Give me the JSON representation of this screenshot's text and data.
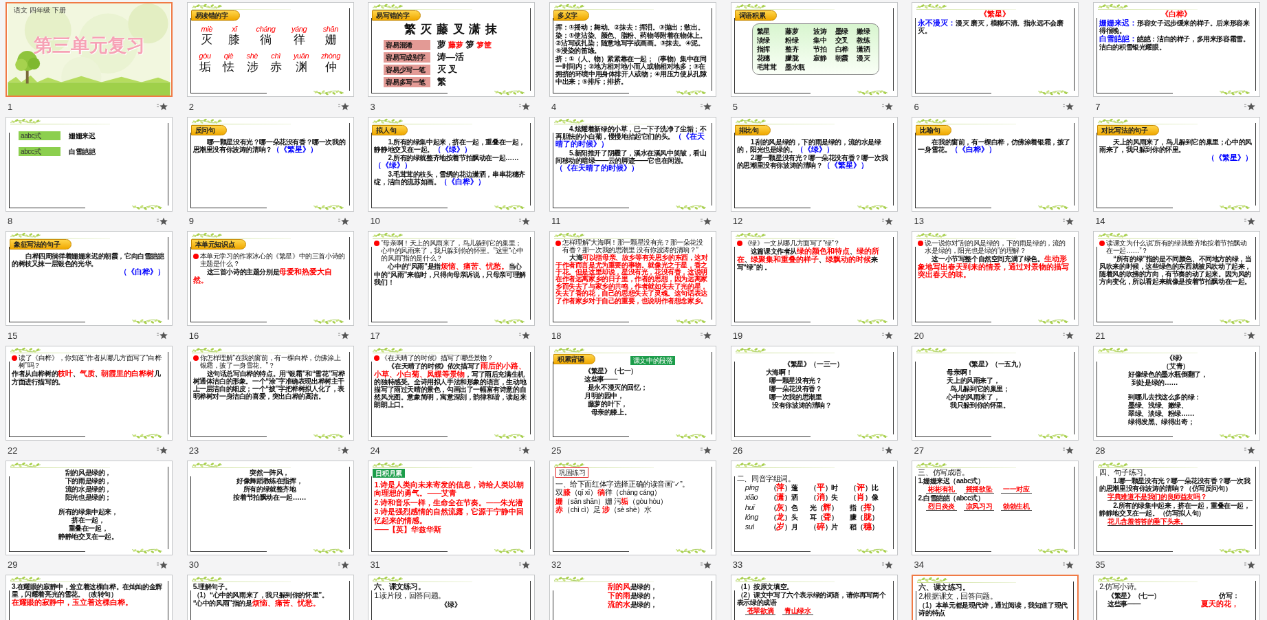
{
  "slides": [
    {
      "number": "1",
      "selected": true,
      "kind": "title",
      "header": "语文  四年级  下册",
      "title": "第三单元复习"
    },
    {
      "number": "2",
      "selected": false,
      "kind": "content",
      "label": {
        "text": "易读错的字",
        "kind": "tab"
      },
      "body": [
        {
          "kind": "pinyin-row",
          "cells": [
            {
              "pinyin": "miè",
              "char": "灭"
            },
            {
              "pinyin": "xī",
              "char": "膝"
            },
            {
              "pinyin": "cháng",
              "char": "徜"
            },
            {
              "pinyin": "yáng",
              "char": "徉"
            },
            {
              "pinyin": "shān",
              "char": "姗"
            }
          ]
        },
        {
          "kind": "pinyin-row",
          "cells": [
            {
              "pinyin": "gòu",
              "char": "垢"
            },
            {
              "pinyin": "qiè",
              "char": "怯"
            },
            {
              "pinyin": "shè",
              "char": "涉"
            },
            {
              "pinyin": "chì",
              "char": "赤"
            },
            {
              "pinyin": "yuān",
              "char": "渊"
            },
            {
              "pinyin": "zhòng",
              "char": "仲"
            }
          ]
        }
      ]
    },
    {
      "number": "3",
      "selected": false,
      "kind": "content",
      "label": {
        "text": "易写错的字",
        "kind": "tab"
      },
      "body": [
        {
          "kind": "big",
          "parts": [
            {
              "text": "繁 灭 藤 叉 潇 抹"
            }
          ]
        },
        {
          "kind": "chip-row",
          "chip": "容易混淆",
          "parts": [
            {
              "text": "萝 "
            },
            {
              "text": "藤萝",
              "color": "#ff0000"
            },
            {
              "text": "  箩 "
            },
            {
              "text": "箩筐",
              "color": "#ff0000"
            }
          ]
        },
        {
          "kind": "chip-row",
          "chip": "容易写成别字",
          "parts": [
            {
              "text": "涛—活"
            }
          ]
        },
        {
          "kind": "chip-row",
          "chip": "容易少写一笔",
          "parts": [
            {
              "text": "灭    叉"
            }
          ]
        },
        {
          "kind": "chip-row",
          "chip": "容易多写一笔",
          "parts": [
            {
              "text": "繁"
            }
          ]
        }
      ]
    },
    {
      "number": "4",
      "selected": false,
      "kind": "content",
      "label": {
        "text": "多义字",
        "kind": "tab"
      },
      "body": [
        {
          "kind": "line",
          "parts": [
            {
              "text": "挥：①摇动；舞动。②抹去：挥泪。③抛出；散出。"
            }
          ]
        },
        {
          "kind": "line",
          "parts": [
            {
              "text": "染：①使沾染、颜色、脂粉、药物等附着在物体上。②沾写或扎染；随意地写字或画画。③抹去。④泥。⑤浸染的笛绦。"
            }
          ]
        },
        {
          "kind": "line",
          "parts": [
            {
              "text": "挤：①（人、物）紧紧靠在一起；（事物）集中在同一时间内；②地方相对地小而人或物相对地多；③在拥挤的环境中用身体排开人或物；④用压力使从孔隙中出来；⑤排斥；排挤。"
            }
          ]
        }
      ]
    },
    {
      "number": "5",
      "selected": false,
      "kind": "content",
      "label": {
        "text": "词语积累",
        "kind": "tab"
      },
      "body": [
        {
          "kind": "word-box",
          "rows": [
            [
              "繁星",
              "藤萝",
              "波涛",
              "墨绿",
              "嫩绿"
            ],
            [
              "淡绿",
              "粉绿",
              "集中",
              "交叉",
              "教练"
            ],
            [
              "指挥",
              "整齐",
              "节拍",
              "白桦",
              "潇洒"
            ],
            [
              "花穗",
              "朦胧",
              "寂静",
              "朝霞",
              "漫灭"
            ],
            [
              "毛茸茸",
              "墨水瓶"
            ]
          ]
        }
      ]
    },
    {
      "number": "6",
      "selected": false,
      "kind": "content",
      "body": [
        {
          "kind": "center",
          "parts": [
            {
              "text": "《繁星》",
              "color": "#ff0000"
            }
          ]
        },
        {
          "kind": "line",
          "parts": [
            {
              "text": "永不漫灭：",
              "color": "#0000ff"
            },
            {
              "text": "漫灭 磨灭，模糊不清。指永远不会磨灭。"
            }
          ]
        }
      ]
    },
    {
      "number": "7",
      "selected": false,
      "kind": "content",
      "body": [
        {
          "kind": "center",
          "parts": [
            {
              "text": "《白桦》",
              "color": "#ff0000"
            }
          ]
        },
        {
          "kind": "line",
          "parts": [
            {
              "text": "姗姗来迟：",
              "color": "#0000ff"
            },
            {
              "text": "形容女子迟步缓来的样子。后来形容来得很晚。"
            }
          ]
        },
        {
          "kind": "line",
          "parts": [
            {
              "text": "白雪皑皑：",
              "color": "#0000ff"
            },
            {
              "text": "皑皑：洁白的样子，多用来形容霜雪。洁白的积雪银光耀眼。"
            }
          ]
        }
      ]
    },
    {
      "number": "8",
      "selected": false,
      "kind": "content",
      "body": [
        {
          "kind": "gap"
        },
        {
          "kind": "green-tag-row",
          "tag": "aabc式",
          "text": "姗姗来迟"
        },
        {
          "kind": "gap"
        },
        {
          "kind": "green-tag-row",
          "tag": "abcc式",
          "text": "白雪皑皑"
        }
      ]
    },
    {
      "number": "9",
      "selected": false,
      "kind": "content",
      "label": {
        "text": "反问句",
        "kind": "tab"
      },
      "body": [
        {
          "kind": "para",
          "parts": [
            {
              "text": "哪一颗星没有光？哪一朵花没有香？哪一次我的思潮里没有你波涛的清响？"
            },
            {
              "text": "（《繁星》）",
              "color": "#0000ff"
            }
          ]
        }
      ]
    },
    {
      "number": "10",
      "selected": false,
      "kind": "content",
      "label": {
        "text": "拟人句",
        "kind": "tab"
      },
      "body": [
        {
          "kind": "para",
          "parts": [
            {
              "text": "1.所有的绿集中起来，挤在一起，重叠在一起，静静地交叉在一起。"
            },
            {
              "text": "（《绿》）",
              "color": "#0000ff"
            }
          ]
        },
        {
          "kind": "para",
          "parts": [
            {
              "text": "2.所有的绿就整齐地按着节拍飘动在一起……"
            },
            {
              "text": "（《绿》）",
              "color": "#0000ff"
            }
          ]
        },
        {
          "kind": "para",
          "parts": [
            {
              "text": "3.毛茸茸的枝头，雪绣的花边潇洒，串串花穗齐绽，洁白的流苏如画。"
            },
            {
              "text": "（《白桦》）",
              "color": "#0000ff"
            }
          ]
        }
      ]
    },
    {
      "number": "11",
      "selected": false,
      "kind": "content",
      "body": [
        {
          "kind": "para",
          "parts": [
            {
              "text": "4.炫耀着新绿的小草，已一下子洗净了尘垢；不再胆怯的小白菊，慢慢地抬起它们的头。"
            },
            {
              "text": "（《在天晴了的时候》）",
              "color": "#0000ff"
            }
          ]
        },
        {
          "kind": "para",
          "parts": [
            {
              "text": "5.新阳推开了阴霾了，溪水在溪风中笑皱，看山间移动的暗绿——云的脚迹——它也在闲游。"
            },
            {
              "text": "（《在天晴了的时候》）",
              "color": "#0000ff"
            }
          ]
        }
      ]
    },
    {
      "number": "12",
      "selected": false,
      "kind": "content",
      "label": {
        "text": "排比句",
        "kind": "tab"
      },
      "body": [
        {
          "kind": "para",
          "parts": [
            {
              "text": "1.刮的风是绿的，下的雨是绿的，流的水是绿的，阳光也是绿的。"
            },
            {
              "text": "（《绿》）",
              "color": "#0000ff"
            }
          ]
        },
        {
          "kind": "para",
          "parts": [
            {
              "text": "2.哪一颗星没有光？哪一朵花没有香？哪一次我的思潮里没有你波涛的清响？"
            },
            {
              "text": "（《繁星》）",
              "color": "#0000ff"
            }
          ]
        }
      ]
    },
    {
      "number": "13",
      "selected": false,
      "kind": "content",
      "label": {
        "text": "比喻句",
        "kind": "tab"
      },
      "body": [
        {
          "kind": "para",
          "parts": [
            {
              "text": "在我的窗前，有一棵白桦，仿佛涂着银霜，披了一身雪花。"
            },
            {
              "text": "（《白桦》）",
              "color": "#0000ff"
            }
          ]
        }
      ]
    },
    {
      "number": "14",
      "selected": false,
      "kind": "content",
      "label": {
        "text": "对比写法的句子",
        "kind": "tab"
      },
      "body": [
        {
          "kind": "para",
          "parts": [
            {
              "text": "天上的风雨来了，鸟儿躲到它的巢里；心中的风雨来了，我只躲到你的怀里。"
            }
          ]
        },
        {
          "kind": "right",
          "parts": [
            {
              "text": "（《繁星》）",
              "color": "#0000ff"
            }
          ]
        }
      ]
    },
    {
      "number": "15",
      "selected": false,
      "kind": "content",
      "label": {
        "text": "象征写法的句子",
        "kind": "tab"
      },
      "body": [
        {
          "kind": "para",
          "parts": [
            {
              "text": "白桦四周徜徉着姗姗来迟的朝霞，它向白雪皑皑的树枝又抹一层银色的光华。"
            }
          ]
        },
        {
          "kind": "right",
          "parts": [
            {
              "text": "（《白桦》）",
              "color": "#0000ff"
            }
          ]
        }
      ]
    },
    {
      "number": "16",
      "selected": false,
      "kind": "content",
      "label": {
        "text": "本单元知识点",
        "kind": "tab"
      },
      "body": [
        {
          "kind": "question",
          "parts": [
            {
              "text": "本单元学习的作家冰心的《繁星》中的三首小诗的主题是什么？"
            }
          ]
        },
        {
          "kind": "para",
          "parts": [
            {
              "text": "这三首小诗的主题分别是"
            },
            {
              "text": "母爱和热爱大自然。",
              "color": "#ff0000"
            }
          ]
        }
      ]
    },
    {
      "number": "17",
      "selected": false,
      "kind": "content",
      "body": [
        {
          "kind": "question",
          "parts": [
            {
              "text": "“母亲啊！天上的风雨来了，鸟儿躲到它的巢里；心中的风雨来了，我只躲到你的怀里。”这里“心中的风雨”指的是什么？"
            }
          ]
        },
        {
          "kind": "para",
          "parts": [
            {
              "text": "心中的“风雨”是指"
            },
            {
              "text": "烦恼、痛苦、忧愁。",
              "color": "#ff0000"
            },
            {
              "text": "当心中的“风雨”来临时，只得向母亲诉说，只母亲可理解我们！"
            }
          ]
        }
      ]
    },
    {
      "number": "18",
      "selected": false,
      "kind": "content",
      "body": [
        {
          "kind": "question",
          "parts": [
            {
              "text": "怎样理解“大海啊！那一颗星没有光？那一朵花没有香？那一次我的思潮里 没有你波涛的清响？”"
            }
          ]
        },
        {
          "kind": "para",
          "parts": [
            {
              "text": "大海"
            },
            {
              "text": "可以指母亲、故乡等有关思乡的东西，这对于作者而言是尤为重要的事物。就像光之于星，香之于花。但是这里却说，星没有光，花没有香，这说明在作者远离家乡的日子里，作者的思想，因为远离家乡而失去了与家乡的共鸣，作者就如失去了光的星，失去了香的花，自己的思想失去了灵魂。这句话表达了作者家乡对于自己的重要，也说明作者想念家乡。",
              "color": "#ff0000"
            }
          ]
        }
      ]
    },
    {
      "number": "19",
      "selected": false,
      "kind": "content",
      "body": [
        {
          "kind": "question",
          "parts": [
            {
              "text": "《绿》一文从哪几方面写了“绿”？"
            }
          ]
        },
        {
          "kind": "para",
          "parts": [
            {
              "text": "这篇课文作者从"
            },
            {
              "text": "绿的颜色和特点",
              "color": "#ff0000"
            },
            {
              "text": "、"
            },
            {
              "text": "绿的所在",
              "color": "#ff0000"
            },
            {
              "text": "、"
            },
            {
              "text": "绿聚集和重叠的样子",
              "color": "#ff0000"
            },
            {
              "text": "、"
            },
            {
              "text": "绿飘动的时候",
              "color": "#ff0000"
            },
            {
              "text": "来写“绿”的 。"
            }
          ]
        }
      ]
    },
    {
      "number": "20",
      "selected": false,
      "kind": "content",
      "body": [
        {
          "kind": "question",
          "parts": [
            {
              "text": "说一说你对“刮的风是绿的，下的雨是绿的，流的水是绿的，阳光也是绿的”的理解？"
            }
          ]
        },
        {
          "kind": "para",
          "parts": [
            {
              "text": "这一小节写整个自然空间充满了绿色。"
            },
            {
              "text": "生动形象地写出春天到来的情景，通过对景物的描写突出春天的味。",
              "color": "#ff0000"
            }
          ]
        }
      ]
    },
    {
      "number": "21",
      "selected": false,
      "kind": "content",
      "body": [
        {
          "kind": "question",
          "parts": [
            {
              "text": "读课文为什么说“所有的绿就整齐地按着节拍飘动在一起……”？"
            }
          ]
        },
        {
          "kind": "para",
          "parts": [
            {
              "text": "“所有的绿”指的是不同颜色、不同地方的绿，当风吹来的时候，这些绿色的东西就被风吹动了起来，随着风的吹拂的方向，有节奏的动了起来。因为风的方向变化，所以看起来就像是按着节拍飘动在一起。"
            }
          ]
        }
      ]
    },
    {
      "number": "22",
      "selected": false,
      "kind": "content",
      "body": [
        {
          "kind": "question",
          "parts": [
            {
              "text": "读了《白桦》，你知道“作者从哪几方面写了“白桦树”吗？"
            }
          ]
        },
        {
          "kind": "line",
          "parts": [
            {
              "text": "作者从白桦树的"
            },
            {
              "text": "枝叶",
              "color": "#ff0000"
            },
            {
              "text": "、"
            },
            {
              "text": "气质",
              "color": "#ff0000"
            },
            {
              "text": "、"
            },
            {
              "text": "朝霞里的白桦树",
              "color": "#ff0000"
            },
            {
              "text": "几方面进行描写的。"
            }
          ]
        }
      ]
    },
    {
      "number": "23",
      "selected": false,
      "kind": "content",
      "body": [
        {
          "kind": "question",
          "parts": [
            {
              "text": "你怎样理解“在我的窗前，有一棵白桦，仿佛涂上银霜，披了一身雪花。”？"
            }
          ]
        },
        {
          "kind": "para",
          "parts": [
            {
              "text": "这句话总写白桦的特点。用“银霜”和“雪花”写桦树通体洁白的形象。一个“涂”字准确表现出桦树主干上一层洁白的细皮；一个“披”字把桦树拟人化了，表明桦树对一身洁白的喜爱，突出白桦的高洁。"
            }
          ]
        }
      ]
    },
    {
      "number": "24",
      "selected": false,
      "kind": "content",
      "body": [
        {
          "kind": "question",
          "parts": [
            {
              "text": "《在天晴了的时候》描写了哪些景物？"
            }
          ]
        },
        {
          "kind": "para",
          "parts": [
            {
              "text": "《在天晴了的时候》依次描写了"
            },
            {
              "text": "雨后的小路、小草、小白菊、凤蝶等景物",
              "color": "#ff0000"
            },
            {
              "text": "，写了雨后充满生机的独特感受。全诗用拟人手法和形象的语言，生动地描写了雨过天晴的景色，勾画出了一幅富有诗意的自然风光图。意象简明，寓意深刻，韵律和谐，读起来朗朗上口。"
            }
          ]
        }
      ]
    },
    {
      "number": "25",
      "selected": false,
      "kind": "content",
      "label": {
        "text": "积累背诵",
        "kind": "tab"
      },
      "body": [
        {
          "kind": "green-label",
          "text": "课文中的段落"
        },
        {
          "kind": "poem",
          "parts": [
            {
              "text": "《繁星》（七一）"
            }
          ]
        },
        {
          "kind": "poem",
          "parts": [
            {
              "text": "这些事——"
            }
          ]
        },
        {
          "kind": "poem",
          "parts": [
            {
              "text": "  是永不漫灭的回忆；"
            }
          ]
        },
        {
          "kind": "poem",
          "parts": [
            {
              "text": "月明的园中，"
            }
          ]
        },
        {
          "kind": "poem",
          "parts": [
            {
              "text": "  藤萝的叶下，"
            }
          ]
        },
        {
          "kind": "poem",
          "parts": [
            {
              "text": "    母亲的膝上。"
            }
          ]
        }
      ]
    },
    {
      "number": "26",
      "selected": false,
      "kind": "content",
      "body": [
        {
          "kind": "gap"
        },
        {
          "kind": "center",
          "parts": [
            {
              "text": "《繁星》（一三一）"
            }
          ]
        },
        {
          "kind": "poem",
          "parts": [
            {
              "text": "大海啊！"
            }
          ]
        },
        {
          "kind": "poem",
          "parts": [
            {
              "text": "  哪一颗星没有光？"
            }
          ]
        },
        {
          "kind": "poem",
          "parts": [
            {
              "text": "  哪一朵花没有香？"
            }
          ]
        },
        {
          "kind": "poem",
          "parts": [
            {
              "text": "  哪一次我的思潮里"
            }
          ]
        },
        {
          "kind": "poem",
          "parts": [
            {
              "text": "    没有你波涛的清响？"
            }
          ]
        }
      ]
    },
    {
      "number": "27",
      "selected": false,
      "kind": "content",
      "body": [
        {
          "kind": "gap"
        },
        {
          "kind": "center",
          "parts": [
            {
              "text": "《繁星》（一五九）"
            }
          ]
        },
        {
          "kind": "poem",
          "parts": [
            {
              "text": "母亲啊！"
            }
          ]
        },
        {
          "kind": "poem",
          "parts": [
            {
              "text": "天上的风雨来了，"
            }
          ]
        },
        {
          "kind": "poem",
          "parts": [
            {
              "text": "  鸟儿躲到它的巢里；"
            }
          ]
        },
        {
          "kind": "poem",
          "parts": [
            {
              "text": "心中的风雨来了，"
            }
          ]
        },
        {
          "kind": "poem",
          "parts": [
            {
              "text": "  我只躲到你的怀里。"
            }
          ]
        }
      ]
    },
    {
      "number": "28",
      "selected": false,
      "kind": "content",
      "body": [
        {
          "kind": "center",
          "parts": [
            {
              "text": "《绿》"
            }
          ]
        },
        {
          "kind": "center",
          "parts": [
            {
              "text": "（艾青）"
            }
          ]
        },
        {
          "kind": "poem",
          "parts": [
            {
              "text": "好像绿色的墨水瓶倒翻了，"
            }
          ]
        },
        {
          "kind": "poem",
          "parts": [
            {
              "text": "  到处是绿的……"
            }
          ]
        },
        {
          "kind": "gap"
        },
        {
          "kind": "poem",
          "parts": [
            {
              "text": "到哪儿去找这么多的绿："
            }
          ]
        },
        {
          "kind": "poem",
          "parts": [
            {
              "text": "墨绿、浅绿、嫩绿、"
            }
          ]
        },
        {
          "kind": "poem",
          "parts": [
            {
              "text": "翠绿、淡绿、粉绿……"
            }
          ]
        },
        {
          "kind": "poem",
          "parts": [
            {
              "text": "绿得发黑、绿得出奇；"
            }
          ]
        }
      ]
    },
    {
      "number": "29",
      "selected": false,
      "kind": "content",
      "body": [
        {
          "kind": "center",
          "parts": [
            {
              "text": "刮的风是绿的，"
            }
          ]
        },
        {
          "kind": "center",
          "parts": [
            {
              "text": "下的雨是绿的，"
            }
          ]
        },
        {
          "kind": "center",
          "parts": [
            {
              "text": "流的水是绿的，"
            }
          ]
        },
        {
          "kind": "center",
          "parts": [
            {
              "text": "阳光也是绿的；"
            }
          ]
        },
        {
          "kind": "gap"
        },
        {
          "kind": "center",
          "parts": [
            {
              "text": "所有的绿集中起来，"
            }
          ]
        },
        {
          "kind": "center",
          "parts": [
            {
              "text": "挤在一起，"
            }
          ]
        },
        {
          "kind": "center",
          "parts": [
            {
              "text": "重叠在一起，"
            }
          ]
        },
        {
          "kind": "center",
          "parts": [
            {
              "text": "静静地交叉在一起。"
            }
          ]
        }
      ]
    },
    {
      "number": "30",
      "selected": false,
      "kind": "content",
      "body": [
        {
          "kind": "center",
          "parts": [
            {
              "text": "突然一阵风，"
            }
          ]
        },
        {
          "kind": "center",
          "parts": [
            {
              "text": "好像舞蹈教练在指挥，"
            }
          ]
        },
        {
          "kind": "center",
          "parts": [
            {
              "text": "所有的绿就整齐地"
            }
          ]
        },
        {
          "kind": "center",
          "parts": [
            {
              "text": "按着节拍飘动在一起……"
            }
          ]
        }
      ]
    },
    {
      "number": "31",
      "selected": false,
      "kind": "content",
      "label": {
        "text": "日积月累",
        "kind": "green"
      },
      "body": [
        {
          "kind": "large",
          "parts": [
            {
              "text": "1.诗是人类向未来寄发的信息，诗给人类以朝向理想的勇气。——艾青",
              "color": "#ff0000"
            }
          ]
        },
        {
          "kind": "large",
          "parts": [
            {
              "text": "2.诗和音乐一样，生命全在节奏。——朱光潜",
              "color": "#ff0000"
            }
          ]
        },
        {
          "kind": "large",
          "parts": [
            {
              "text": "3.诗是强烈感情的自然流露，它源于宁静中回忆起来的情感。",
              "color": "#ff0000"
            }
          ]
        },
        {
          "kind": "large",
          "parts": [
            {
              "text": "——【英】华兹华斯",
              "color": "#ff0000"
            }
          ]
        }
      ]
    },
    {
      "number": "32",
      "selected": false,
      "kind": "content",
      "label": {
        "text": "巩固练习",
        "kind": "boxed"
      },
      "body": [
        {
          "kind": "plain",
          "parts": [
            {
              "text": "一、给下面红体字选择正确的读音画“✓”。"
            }
          ]
        },
        {
          "kind": "plain",
          "parts": [
            {
              "text": "双"
            },
            {
              "text": "膝",
              "color": "#ff0000"
            },
            {
              "text": "（qī xī）"
            },
            {
              "text": "徜",
              "color": "#ff0000"
            },
            {
              "text": "徉（cháng cáng）"
            }
          ]
        },
        {
          "kind": "plain",
          "parts": [
            {
              "text": "姗",
              "color": "#ff0000"
            },
            {
              "text": "（sān shān）姗  污"
            },
            {
              "text": "垢",
              "color": "#ff0000"
            },
            {
              "text": "（gòu hòu）"
            }
          ]
        },
        {
          "kind": "plain",
          "parts": [
            {
              "text": "赤",
              "color": "#ff0000"
            },
            {
              "text": "（chì cì）足  "
            },
            {
              "text": "涉",
              "color": "#ff0000"
            },
            {
              "text": "（sè shè）水"
            }
          ]
        }
      ]
    },
    {
      "number": "33",
      "selected": false,
      "kind": "content",
      "body": [
        {
          "kind": "gap"
        },
        {
          "kind": "plain",
          "parts": [
            {
              "text": "二、同音字组词。"
            }
          ]
        },
        {
          "kind": "sound-row",
          "pinyin": "píng",
          "cells": [
            [
              {
                "text": "（"
              },
              {
                "text": "萍",
                "color": "#ff0000"
              },
              {
                "text": "）蓬"
              }
            ],
            [
              {
                "text": "（"
              },
              {
                "text": "平",
                "color": "#ff0000"
              },
              {
                "text": "）时"
              }
            ],
            [
              {
                "text": "（"
              },
              {
                "text": "评",
                "color": "#ff0000"
              },
              {
                "text": "）比"
              }
            ]
          ]
        },
        {
          "kind": "sound-row",
          "pinyin": "xiāo",
          "cells": [
            [
              {
                "text": "（"
              },
              {
                "text": "潇",
                "color": "#ff0000"
              },
              {
                "text": "）洒"
              }
            ],
            [
              {
                "text": "（"
              },
              {
                "text": "消",
                "color": "#ff0000"
              },
              {
                "text": "）失"
              }
            ],
            [
              {
                "text": "（"
              },
              {
                "text": "肖",
                "color": "#ff0000"
              },
              {
                "text": "）像"
              }
            ]
          ]
        },
        {
          "kind": "sound-row",
          "pinyin": "huī",
          "cells": [
            [
              {
                "text": "（"
              },
              {
                "text": "灰",
                "color": "#ff0000"
              },
              {
                "text": "）色"
              }
            ],
            [
              {
                "text": "光（"
              },
              {
                "text": "辉",
                "color": "#ff0000"
              },
              {
                "text": "）"
              }
            ],
            [
              {
                "text": "指（"
              },
              {
                "text": "挥",
                "color": "#ff0000"
              },
              {
                "text": "）"
              }
            ]
          ]
        },
        {
          "kind": "sound-row",
          "pinyin": "lóng",
          "cells": [
            [
              {
                "text": "（"
              },
              {
                "text": "龙",
                "color": "#ff0000"
              },
              {
                "text": "）头"
              }
            ],
            [
              {
                "text": "耳（"
              },
              {
                "text": "聋",
                "color": "#ff0000"
              },
              {
                "text": "）"
              }
            ],
            [
              {
                "text": "朦（"
              },
              {
                "text": "胧",
                "color": "#ff0000"
              },
              {
                "text": "）"
              }
            ]
          ]
        },
        {
          "kind": "sound-row",
          "pinyin": "suì",
          "cells": [
            [
              {
                "text": "（"
              },
              {
                "text": "岁",
                "color": "#ff0000"
              },
              {
                "text": "）月"
              }
            ],
            [
              {
                "text": "（"
              },
              {
                "text": "碎",
                "color": "#ff0000"
              },
              {
                "text": "）片"
              }
            ],
            [
              {
                "text": "稻（"
              },
              {
                "text": "穗",
                "color": "#ff0000"
              },
              {
                "text": "）"
              }
            ]
          ]
        }
      ]
    },
    {
      "number": "34",
      "selected": false,
      "kind": "content",
      "body": [
        {
          "kind": "plain",
          "parts": [
            {
              "text": "三、仿写成语。"
            }
          ]
        },
        {
          "kind": "line",
          "parts": [
            {
              "text": "1.姗姗来迟（aabc式）"
            }
          ]
        },
        {
          "kind": "answer-row",
          "answers": [
            "彬彬有礼",
            "摇摇欲坠",
            "一一对应"
          ]
        },
        {
          "kind": "line",
          "parts": [
            {
              "text": "2.白雪皑皑（abcc式）"
            }
          ]
        },
        {
          "kind": "answer-row",
          "answers": [
            "烈日炎炎",
            "凉风习习",
            "勃勃生机"
          ]
        }
      ]
    },
    {
      "number": "35",
      "selected": false,
      "kind": "content",
      "body": [
        {
          "kind": "plain",
          "parts": [
            {
              "text": "四、句子练习。"
            }
          ]
        },
        {
          "kind": "para",
          "parts": [
            {
              "text": "1.哪一颗星没有光？哪一朵花没有香？哪一次我的思潮里没有你波涛的清响？（仿写反问句）"
            }
          ]
        },
        {
          "kind": "answer-line",
          "text": "字典难道不是我们的良师益友吗？"
        },
        {
          "kind": "para",
          "parts": [
            {
              "text": "2.所有的绿集中起来，挤在一起，重叠在一起，静静地交叉在一起。（仿写拟人句）"
            }
          ]
        },
        {
          "kind": "answer-line",
          "text": "花儿含羞答答的垂下头来。"
        }
      ]
    },
    {
      "selected": false,
      "kind": "content",
      "body": [
        {
          "kind": "line",
          "parts": [
            {
              "text": "3.在耀眼的寂静中，耸立着这棵白桦。在灿灿的金辉里，闪耀着亮光的雪花。（改转句）"
            }
          ]
        },
        {
          "kind": "line",
          "parts": [
            {
              "text": "在耀眼的寂静中，玉立着这棵白桦。",
              "color": "#ff0000"
            }
          ]
        }
      ]
    },
    {
      "selected": false,
      "kind": "content",
      "body": [
        {
          "kind": "line",
          "parts": [
            {
              "text": "5.理解句子。"
            }
          ]
        },
        {
          "kind": "line",
          "parts": [
            {
              "text": "（1）“心中的风雨来了，我只躲到你的怀里”。"
            }
          ]
        },
        {
          "kind": "line",
          "parts": [
            {
              "text": "“心中的风雨”指的是"
            },
            {
              "text": "烦恼、痛苦、忧愁。",
              "color": "#ff0000"
            }
          ]
        }
      ]
    },
    {
      "selected": false,
      "kind": "content",
      "body": [
        {
          "kind": "heading",
          "parts": [
            {
              "text": "六、课文练习。"
            }
          ]
        },
        {
          "kind": "plain",
          "parts": [
            {
              "text": "1.读片段，回答问题。"
            }
          ]
        },
        {
          "kind": "center",
          "parts": [
            {
              "text": "《绿》"
            }
          ]
        }
      ]
    },
    {
      "selected": false,
      "kind": "content",
      "body": [
        {
          "kind": "center",
          "parts": [
            {
              "text": "刮的风",
              "color": "#ff0000"
            },
            {
              "text": "是绿的，"
            }
          ]
        },
        {
          "kind": "center",
          "parts": [
            {
              "text": "下的雨",
              "color": "#ff0000"
            },
            {
              "text": "是绿的，"
            }
          ]
        },
        {
          "kind": "center",
          "parts": [
            {
              "text": "流的水",
              "color": "#ff0000"
            },
            {
              "text": "是绿的，"
            }
          ]
        }
      ]
    },
    {
      "selected": false,
      "kind": "content",
      "body": [
        {
          "kind": "line",
          "parts": [
            {
              "text": "（1）按原文填空。"
            }
          ]
        },
        {
          "kind": "line",
          "parts": [
            {
              "text": "（2）课文中写了六个表示绿的词语，请你再写两个表示绿的成语"
            }
          ]
        },
        {
          "kind": "answer-row",
          "answers": [
            "苍翠欲滴",
            "青山绿水"
          ]
        }
      ]
    },
    {
      "selected": true,
      "kind": "content",
      "body": [
        {
          "kind": "heading",
          "parts": [
            {
              "text": "六、课文练习。"
            }
          ]
        },
        {
          "kind": "plain",
          "parts": [
            {
              "text": "2.根据课文，回答问题。"
            }
          ]
        },
        {
          "kind": "line",
          "parts": [
            {
              "text": "（1）本单元都是现代诗，通过阅读，我知道了现代诗的特点"
            }
          ]
        }
      ]
    },
    {
      "selected": false,
      "kind": "content",
      "body": [
        {
          "kind": "plain",
          "parts": [
            {
              "text": "2.仿写小诗。"
            }
          ]
        },
        {
          "kind": "two-col",
          "left": [
            {
              "text": "《繁星》（七一）"
            }
          ],
          "right": [
            {
              "text": "仿写："
            }
          ]
        },
        {
          "kind": "two-col",
          "left": [
            {
              "text": "这些事——"
            }
          ],
          "right": [
            {
              "text": "夏天的花，",
              "color": "#ff0000"
            }
          ]
        }
      ]
    }
  ]
}
